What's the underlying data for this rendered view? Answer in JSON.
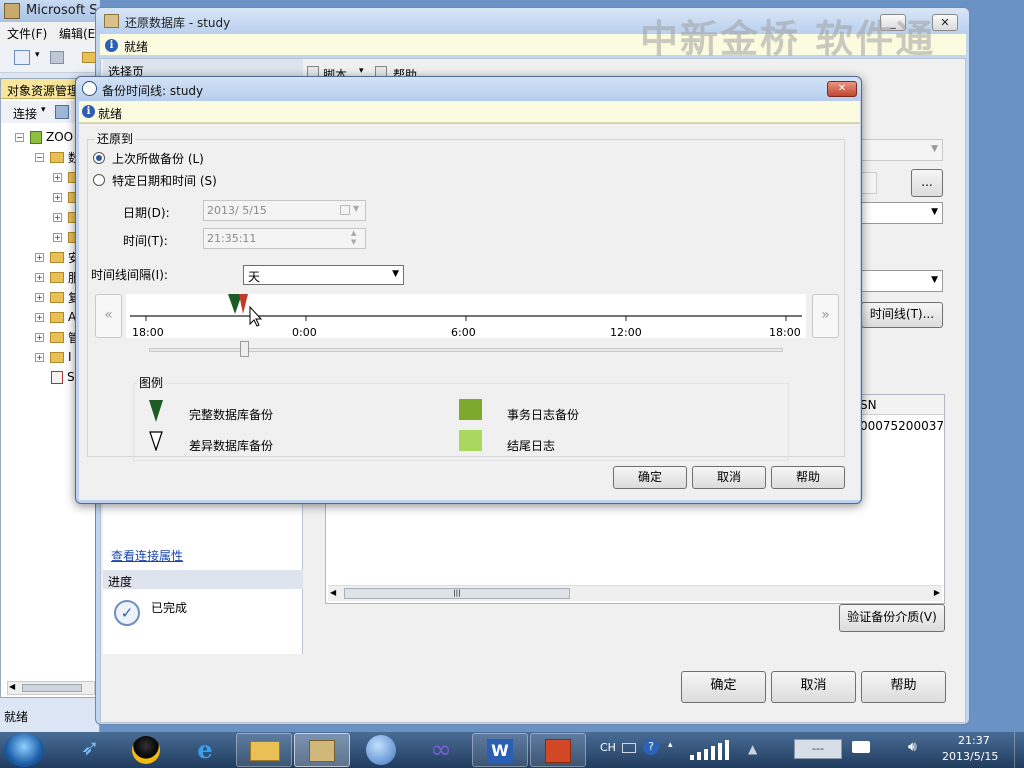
{
  "ssms": {
    "title": "Microsoft S",
    "menu": [
      "文件(F)",
      "编辑(E"
    ],
    "oe_title": "对象资源管理",
    "connect_label": "连接",
    "server_node": "ZOO",
    "status": "就绪",
    "tree_letters": [
      "数",
      "安",
      "服",
      "复",
      "A",
      "管",
      "I",
      "S"
    ]
  },
  "restore": {
    "title": "还原数据库 - study",
    "status": "就绪",
    "select_page": "选择页",
    "script_label": "脚本",
    "help_label": "帮助",
    "browse_label": "...",
    "timeline_btn": "时间线(T)...",
    "lsn_header": "SN",
    "lsn_value": "00075200037",
    "view_conn": "查看连接属性",
    "progress_header": "进度",
    "progress_status": "已完成",
    "verify_btn": "验证备份介质(V)",
    "ok": "确定",
    "cancel": "取消",
    "help": "帮助"
  },
  "watermark": "中新金桥  软件通",
  "timeline": {
    "title": "备份时间线: study",
    "status": "就绪",
    "restore_to_group": "还原到",
    "opt_last": "上次所做备份 (L)",
    "opt_specific": "特定日期和时间 (S)",
    "date_label": "日期(D):",
    "date_value": "2013/ 5/15",
    "time_label": "时间(T):",
    "time_value": "21:35:11",
    "interval_label": "时间线间隔(I):",
    "interval_value": "天",
    "ticks": [
      "18:00",
      "0:00",
      "6:00",
      "12:00",
      "18:00"
    ],
    "legend_title": "图例",
    "legend": {
      "full_db": "完整数据库备份",
      "diff_db": "差异数据库备份",
      "log_backup": "事务日志备份",
      "tail_log": "结尾日志"
    },
    "colors": {
      "full": "#1e5b24",
      "log": "#7daa2c",
      "tail": "#a9d85e"
    },
    "ok": "确定",
    "cancel": "取消",
    "help": "帮助"
  },
  "taskbar": {
    "ime": "CH",
    "time": "21:37",
    "date": "2013/5/15",
    "vol_text": "---"
  }
}
